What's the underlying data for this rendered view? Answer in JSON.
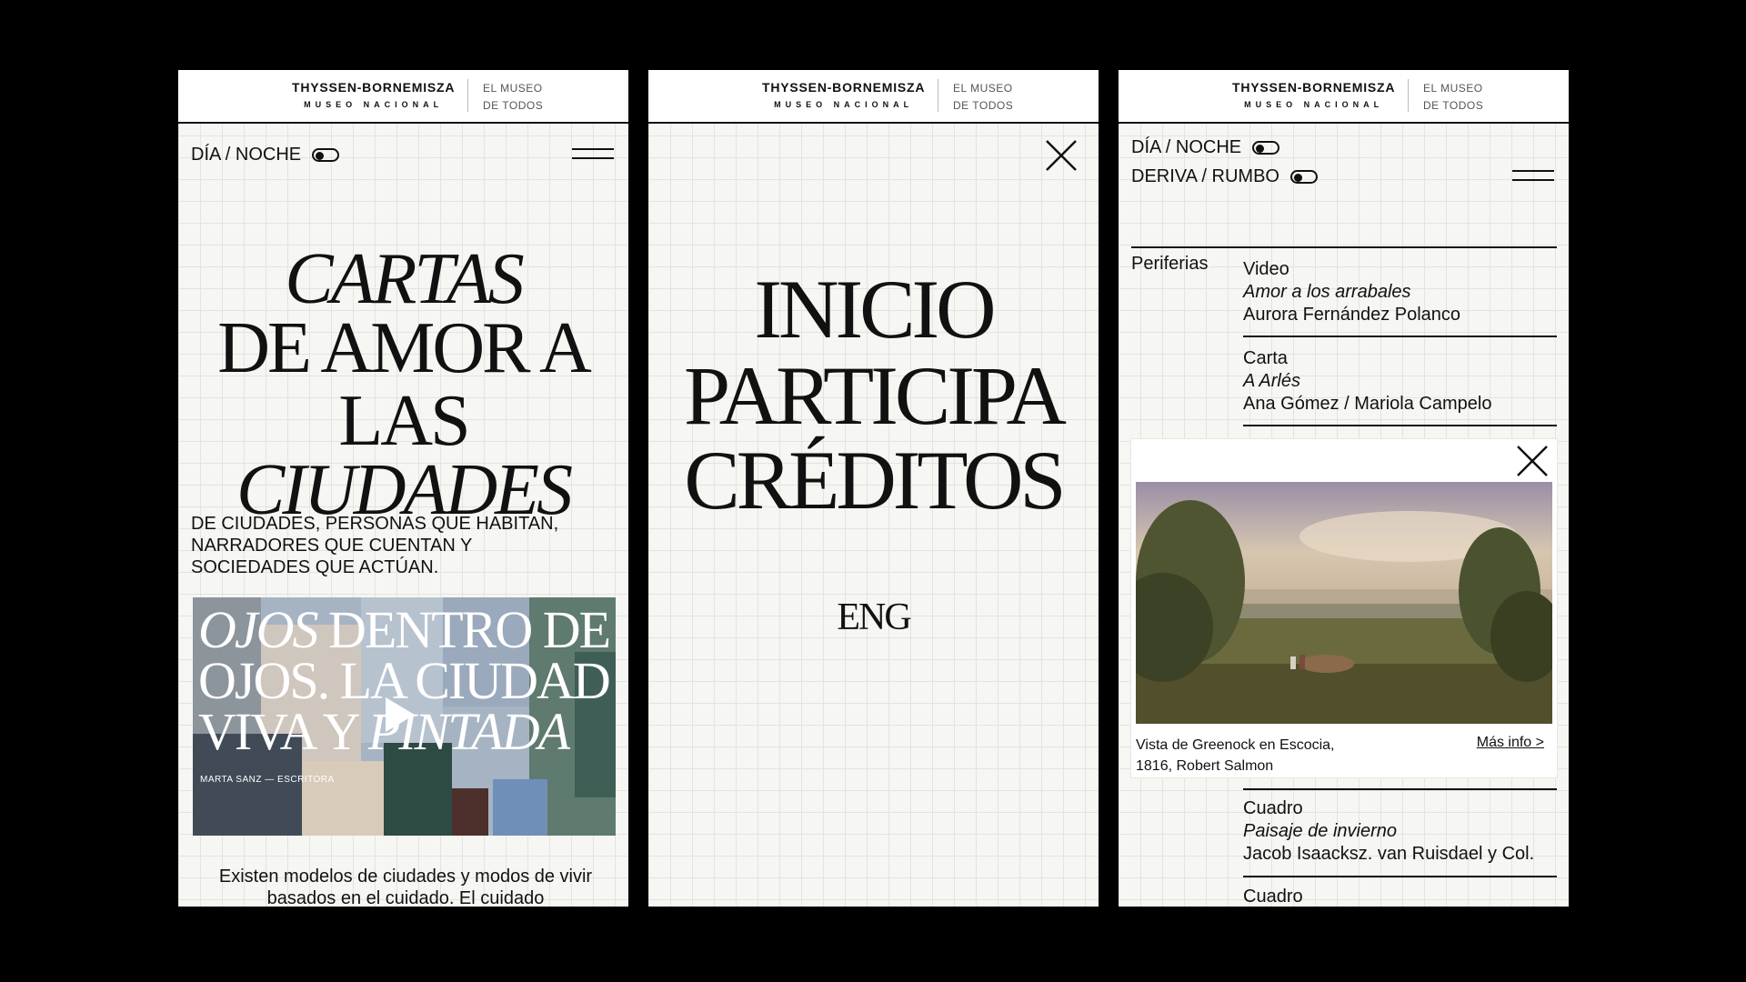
{
  "brand": {
    "name": "THYSSEN-BORNEMISZA",
    "subtitle": "MUSEO NACIONAL",
    "tagline_line1": "EL MUSEO",
    "tagline_line2": "DE TODOS"
  },
  "screen1": {
    "toggle_label": "DÍA / NOCHE",
    "headline_line1": "CARTAS",
    "headline_line2": "DE AMOR A LAS",
    "headline_line3": "CIUDADES",
    "lede": "DE CIUDADES, PERSONAS QUE HABITAN, NARRADORES QUE CUENTAN Y SOCIEDADES QUE ACTÚAN.",
    "video": {
      "title_italic1": "OJOS",
      "title_part1": " DENTRO DE",
      "title_line2": "OJOS. LA CIUDAD",
      "title_part3": "VIVA Y ",
      "title_italic3": "PINTADA",
      "credit": "MARTA SANZ — ESCRITORA"
    },
    "body_text": "Existen modelos de ciudades y modos de vivir basados en el cuidado. El cuidado"
  },
  "screen2": {
    "menu": [
      "INICIO",
      "PARTICIPA",
      "CRÉDITOS"
    ],
    "language": "ENG"
  },
  "screen3": {
    "toggle1_label": "DÍA / NOCHE",
    "toggle2_label": "DERIVA / RUMBO",
    "section_label": "Periferias",
    "entries": [
      {
        "type": "Video",
        "title": "Amor a los arrabales",
        "author": "Aurora Fernández Polanco"
      },
      {
        "type": "Carta",
        "title": "A Arlés",
        "author": "Ana Gómez / Mariola Campelo"
      },
      {
        "type": "Cuadro",
        "title": "Paisaje de invierno",
        "author": "Jacob Isaacksz. van Ruisdael y Col."
      },
      {
        "type": "Cuadro"
      }
    ],
    "card": {
      "caption_line1": "Vista de Greenock en Escocia,",
      "caption_line2": "1816, Robert Salmon",
      "more_link": "Más info >"
    }
  }
}
